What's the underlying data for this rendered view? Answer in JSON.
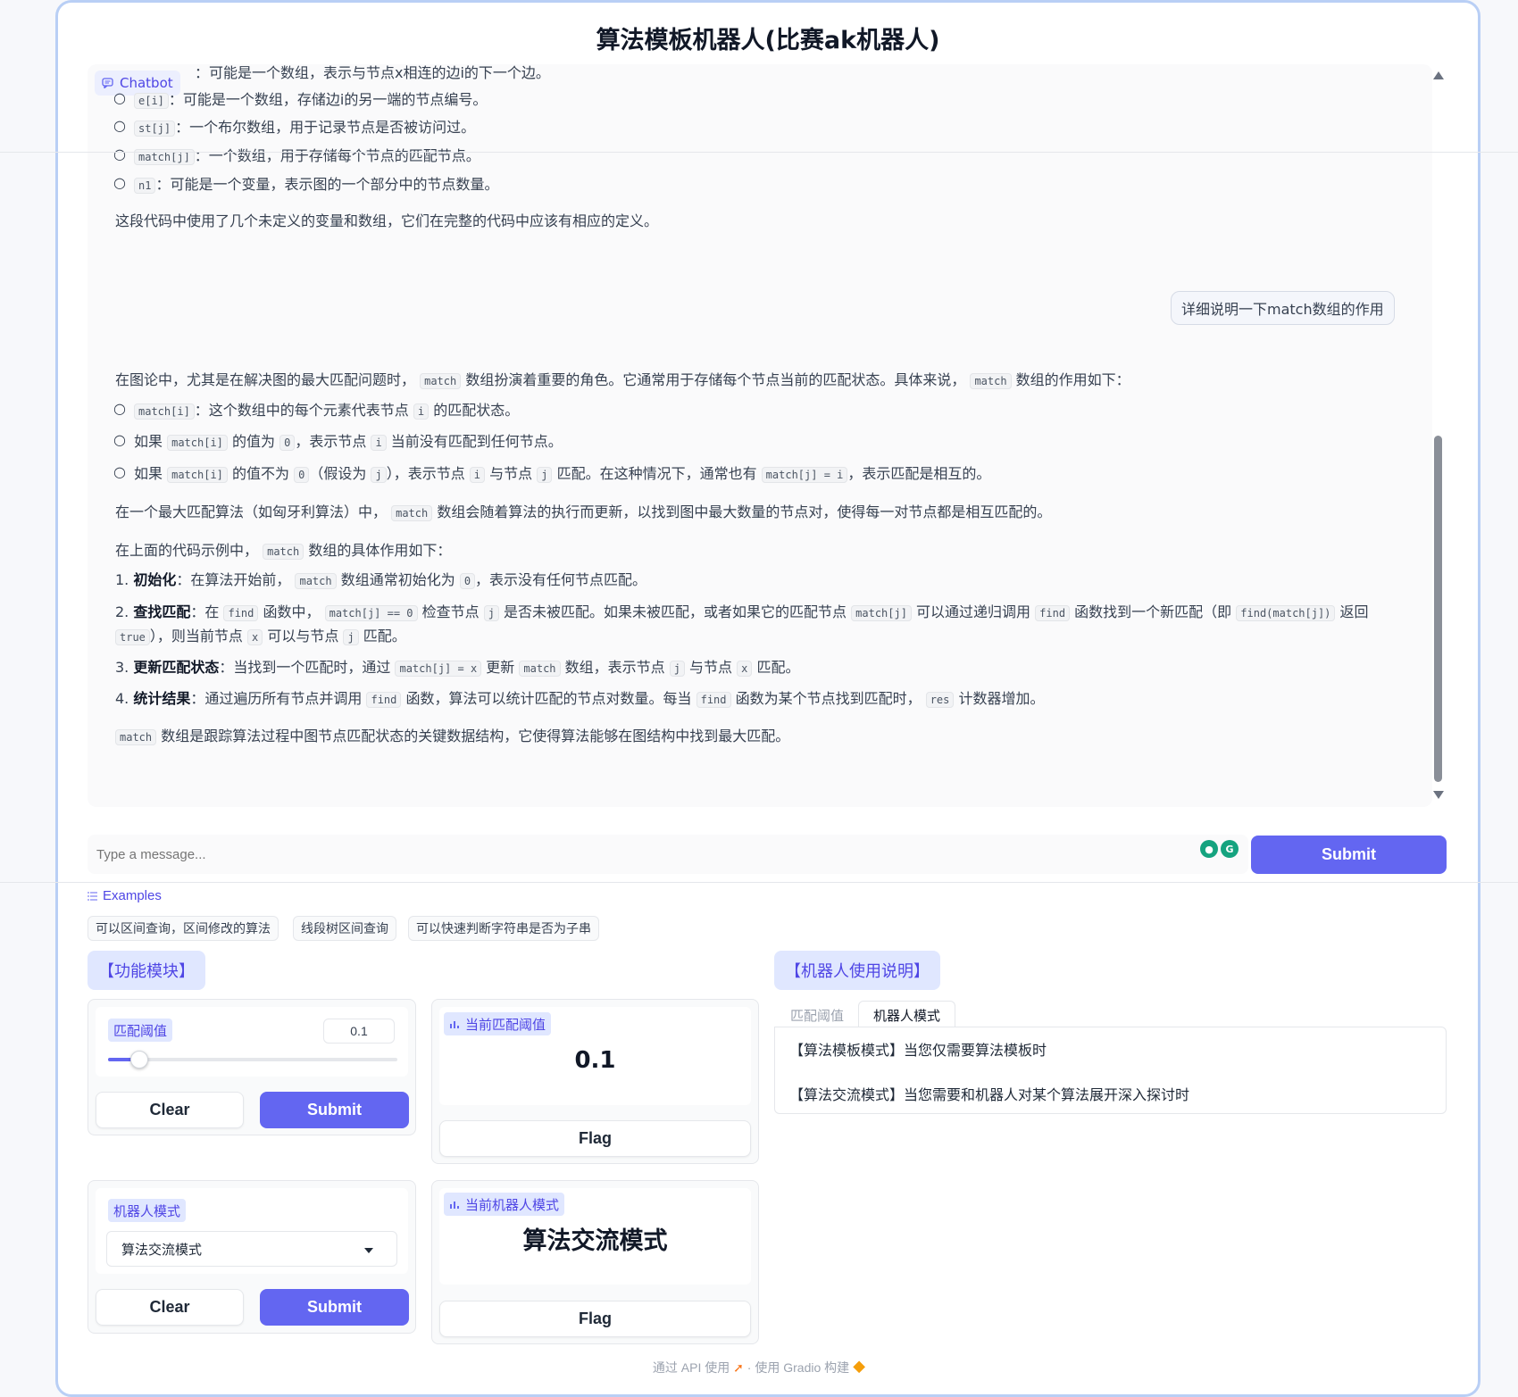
{
  "app": {
    "title": "算法模板机器人(比赛ak机器人)"
  },
  "chat": {
    "label": "Chatbot",
    "top_lines": [
      {
        "code": "",
        "text": "：可能是一个数组，表示与节点x相连的边i的下一个边。"
      },
      {
        "code": "e[i]",
        "text": "：可能是一个数组，存储边i的另一端的节点编号。"
      },
      {
        "code": "st[j]",
        "text": "：一个布尔数组，用于记录节点是否被访问过。"
      },
      {
        "code": "match[j]",
        "text": "：一个数组，用于存储每个节点的匹配节点。"
      },
      {
        "code": "n1",
        "text": "：可能是一个变量，表示图的一个部分中的节点数量。"
      }
    ],
    "summary_line": "这段代码中使用了几个未定义的变量和数组，它们在完整的代码中应该有相应的定义。",
    "user_message": "详细说明一下match数组的作用",
    "answer": {
      "intro_a": "在图论中，尤其是在解决图的最大匹配问题时，",
      "intro_code1": "match",
      "intro_b": "数组扮演着重要的角色。它通常用于存储每个节点当前的匹配状态。具体来说，",
      "intro_code2": "match",
      "intro_c": "数组的作用如下：",
      "b1_code": "match[i]",
      "b1_a": "：这个数组中的每个元素代表节点",
      "b1_code2": "i",
      "b1_b": "的匹配状态。",
      "b2_a": "如果",
      "b2_code": "match[i]",
      "b2_b": "的值为",
      "b2_code2": "0",
      "b2_c": "，表示节点",
      "b2_code3": "i",
      "b2_d": "当前没有匹配到任何节点。",
      "b3_a": "如果",
      "b3_code": "match[i]",
      "b3_b": "的值不为",
      "b3_code2": "0",
      "b3_c": "（假设为",
      "b3_code3": "j",
      "b3_d": "），表示节点",
      "b3_code4": "i",
      "b3_e": "与节点",
      "b3_code5": "j",
      "b3_f": "匹配。在这种情况下，通常也有",
      "b3_code6": "match[j] = i",
      "b3_g": "，表示匹配是相互的。",
      "p2_a": "在一个最大匹配算法（如匈牙利算法）中，",
      "p2_code": "match",
      "p2_b": "数组会随着算法的执行而更新，以找到图中最大数量的节点对，使得每一对节点都是相互匹配的。",
      "p3_a": "在上面的代码示例中，",
      "p3_code": "match",
      "p3_b": "数组的具体作用如下：",
      "n1_num": "1.",
      "n1_bold": "初始化",
      "n1_a": "：在算法开始前，",
      "n1_code": "match",
      "n1_b": "数组通常初始化为",
      "n1_code2": "0",
      "n1_c": "，表示没有任何节点匹配。",
      "n2_num": "2.",
      "n2_bold": "查找匹配",
      "n2_a": "：在",
      "n2_code": "find",
      "n2_b": "函数中，",
      "n2_code2": "match[j] == 0",
      "n2_c": "检查节点",
      "n2_code3": "j",
      "n2_d": "是否未被匹配。如果未被匹配，或者如果它的匹配节点",
      "n2_code4": "match[j]",
      "n2_e": "可以通过递归调用",
      "n2_code5": "find",
      "n2_f": "函数找到一个新匹配（即",
      "n2_code6": "find(match[j])",
      "n2_g": "返回",
      "n2_code7": "true",
      "n2_h": "），则当前节点",
      "n2_code8": "x",
      "n2_i": "可以与节点",
      "n2_code9": "j",
      "n2_j": "匹配。",
      "n3_num": "3.",
      "n3_bold": "更新匹配状态",
      "n3_a": "：当找到一个匹配时，通过",
      "n3_code": "match[j] = x",
      "n3_b": "更新",
      "n3_code2": "match",
      "n3_c": "数组，表示节点",
      "n3_code3": "j",
      "n3_d": "与节点",
      "n3_code4": "x",
      "n3_e": "匹配。",
      "n4_num": "4.",
      "n4_bold": "统计结果",
      "n4_a": "：通过遍历所有节点并调用",
      "n4_code": "find",
      "n4_b": "函数，算法可以统计匹配的节点对数量。每当",
      "n4_code2": "find",
      "n4_c": "函数为某个节点找到匹配时，",
      "n4_code3": "res",
      "n4_d": "计数器增加。",
      "end_code": "match",
      "end_text": "数组是跟踪算法过程中图节点匹配状态的关键数据结构，它使得算法能够在图结构中找到最大匹配。"
    }
  },
  "input": {
    "placeholder": "Type a message...",
    "submit_label": "Submit"
  },
  "examples": {
    "label": "Examples",
    "items": [
      "可以区间查询，区间修改的算法",
      "线段树区间查询",
      "可以快速判断字符串是否为子串"
    ]
  },
  "modules": {
    "title": "【功能模块】",
    "threshold": {
      "label": "匹配阈值",
      "value": "0.1",
      "slider_fraction": 0.1,
      "clear": "Clear",
      "submit": "Submit"
    },
    "threshold_output": {
      "label": "当前匹配阈值",
      "value": "0.1",
      "flag": "Flag"
    },
    "mode": {
      "label": "机器人模式",
      "value": "算法交流模式",
      "clear": "Clear",
      "submit": "Submit"
    },
    "mode_output": {
      "label": "当前机器人模式",
      "value": "算法交流模式",
      "flag": "Flag"
    }
  },
  "instructions": {
    "title": "【机器人使用说明】",
    "tabs": [
      "匹配阈值",
      "机器人模式"
    ],
    "active_tab": "机器人模式",
    "lines": [
      "【算法模板模式】当您仅需要算法模板时",
      "【算法交流模式】当您需要和机器人对某个算法展开深入探讨时"
    ]
  },
  "footer": {
    "api": "通过 API 使用",
    "sep": "·",
    "built": "使用 Gradio 构建"
  },
  "colors": {
    "accent": "#6366f1",
    "frame_border": "#b9cff5",
    "tag_bg": "#e0e7ff"
  }
}
